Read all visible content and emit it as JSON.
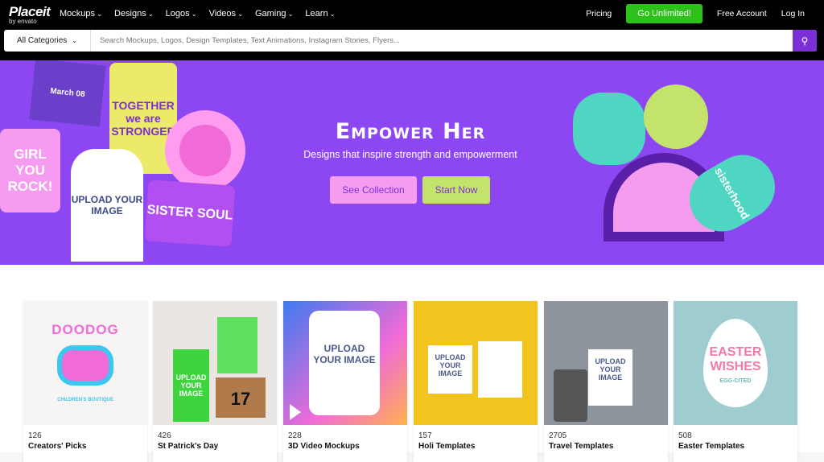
{
  "header": {
    "logo": "Placeit",
    "logo_sub": "by envato",
    "nav": [
      "Mockups",
      "Designs",
      "Logos",
      "Videos",
      "Gaming",
      "Learn"
    ],
    "pricing": "Pricing",
    "cta": "Go Unlimited!",
    "free_account": "Free Account",
    "login": "Log In"
  },
  "search": {
    "category": "All Categories",
    "placeholder": "Search Mockups, Logos, Design Templates, Text Animations, Instagram Stories, Flyers...",
    "icon": "search-icon"
  },
  "hero": {
    "title": "Empower Her",
    "subtitle": "Designs that inspire strength and empowerment",
    "see_collection": "See Collection",
    "start_now": "Start Now",
    "art": {
      "girl_rock": "GIRL YOU ROCK!",
      "together": "TOGETHER we are STRONGER",
      "sister_soul": "SISTER SOUL",
      "sisterhood": "sisterhood",
      "march": "March 08",
      "upload": "UPLOAD YOUR IMAGE"
    },
    "colors": {
      "bg": "#8d47f2",
      "pink": "#f69cf0",
      "lime": "#c4e36b"
    }
  },
  "cards": [
    {
      "count": "126",
      "title": "Creators' Picks",
      "art": "DOODOG",
      "art_sub": "CHILDREN'S BOUTIQUE",
      "bg": "#f7f5f4"
    },
    {
      "count": "426",
      "title": "St Patrick's Day",
      "art": "UPLOAD YOUR IMAGE",
      "art_sub": "17",
      "bg": "#e9e6e3"
    },
    {
      "count": "228",
      "title": "3D Video Mockups",
      "art": "UPLOAD YOUR IMAGE",
      "art_sub": "",
      "bg": "linear-gradient(135deg,#3b7bf0,#f06bd8 60%,#ffb14e)"
    },
    {
      "count": "157",
      "title": "Holi Templates",
      "art": "UPLOAD YOUR IMAGE",
      "art_sub": "",
      "bg": "#f2c420"
    },
    {
      "count": "2705",
      "title": "Travel Templates",
      "art": "UPLOAD YOUR IMAGE",
      "art_sub": "",
      "bg": "#8e959c"
    },
    {
      "count": "508",
      "title": "Easter Templates",
      "art": "EASTER WISHES",
      "art_sub": "EGG-CITED",
      "bg": "#9fcdcf"
    }
  ]
}
